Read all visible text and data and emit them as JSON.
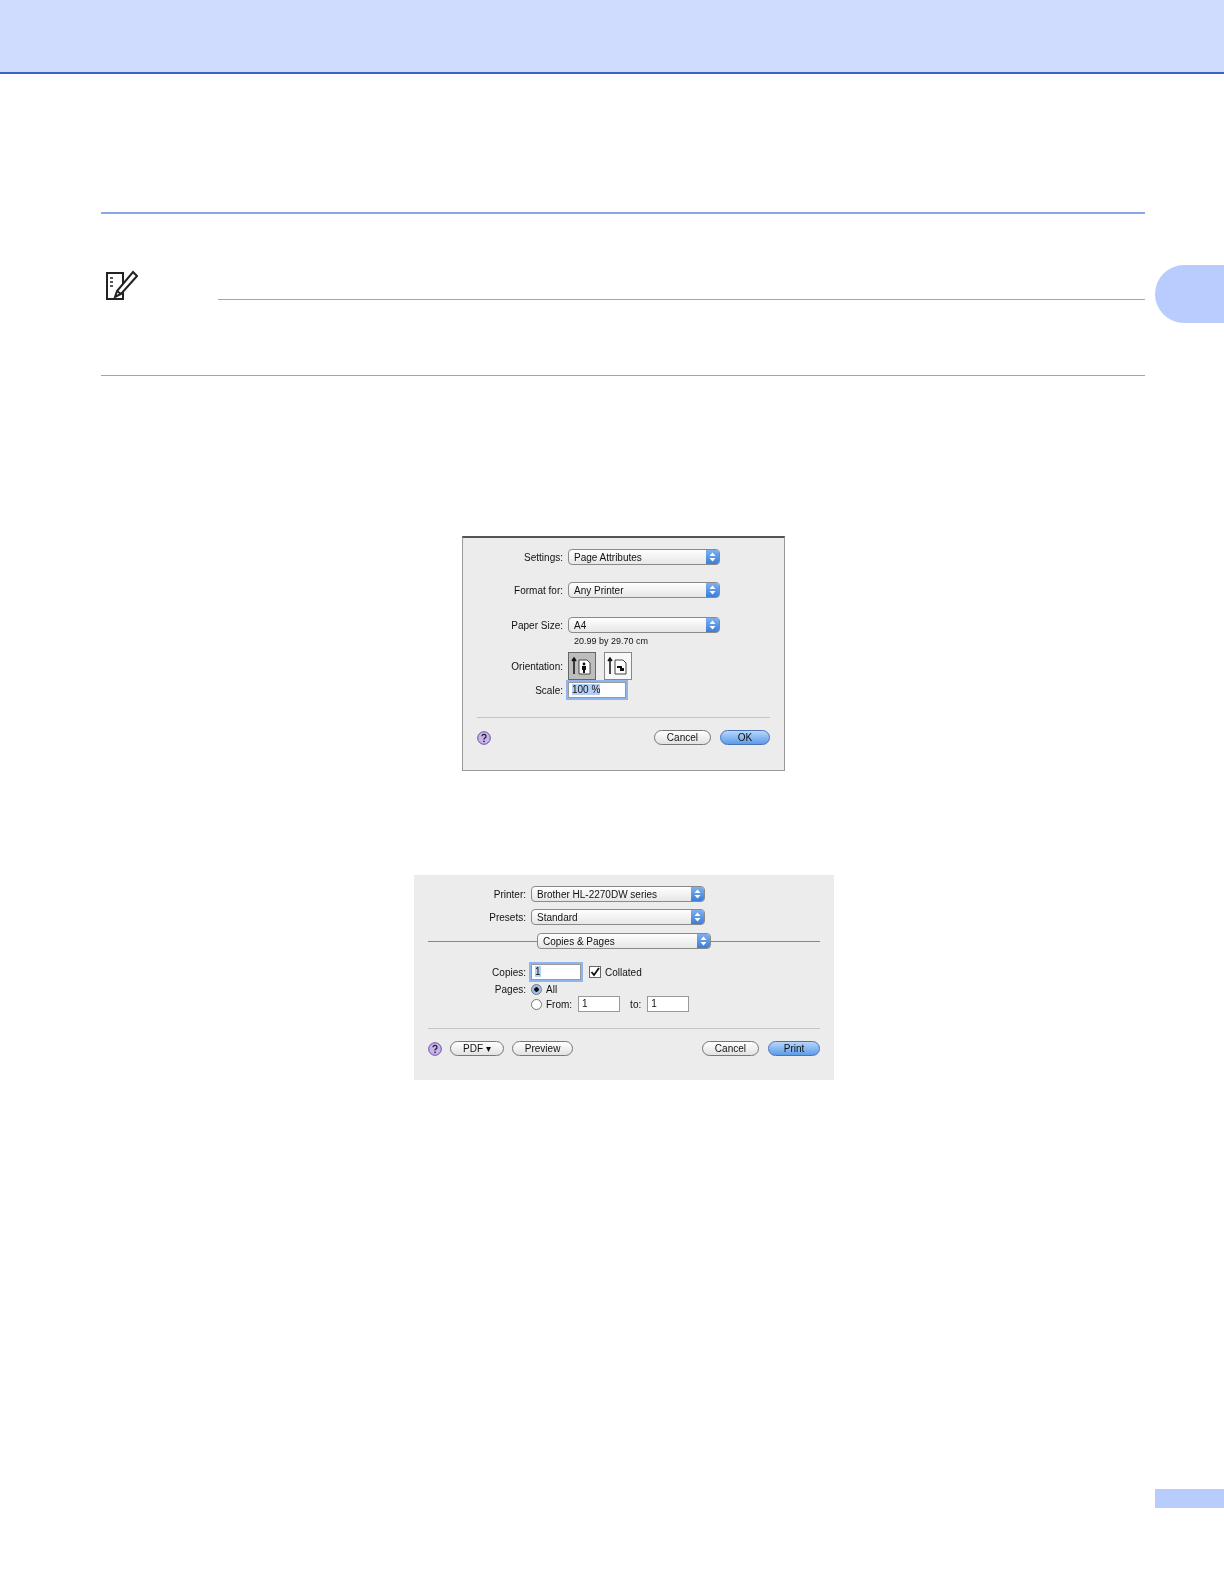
{
  "page_setup_dialog": {
    "rows": [
      {
        "kind": "popup",
        "label": "Settings:",
        "value": "Page Attributes"
      },
      {
        "kind": "popup",
        "label": "Format for:",
        "value": "Any Printer"
      },
      {
        "kind": "popup",
        "label": "Paper Size:",
        "value": "A4",
        "note": "20.99 by 29.70 cm"
      },
      {
        "kind": "orientation",
        "label": "Orientation:",
        "options": [
          {
            "kind": "portrait",
            "selected": true
          },
          {
            "kind": "landscape",
            "selected": false
          }
        ]
      },
      {
        "kind": "text",
        "label": "Scale:",
        "value": "100 %",
        "focused": true
      }
    ],
    "buttons": [
      {
        "label": "Cancel",
        "default": false
      },
      {
        "label": "OK",
        "default": true
      }
    ]
  },
  "print_dialog": {
    "rows": [
      {
        "kind": "popup",
        "label": "Printer:",
        "value": "Brother HL-2270DW series"
      },
      {
        "kind": "popup",
        "label": "Presets:",
        "value": "Standard"
      },
      {
        "kind": "section",
        "value": "Copies & Pages"
      },
      {
        "kind": "copies",
        "label": "Copies:",
        "value": "1",
        "focused": true,
        "checkbox": {
          "label": "Collated",
          "checked": true
        }
      },
      {
        "kind": "radio",
        "label": "Pages:",
        "option": "All",
        "selected": true
      },
      {
        "kind": "range",
        "option": "From:",
        "selected": false,
        "from": "1",
        "to_label": "to:",
        "to": "1"
      }
    ],
    "left_buttons": [
      {
        "label": "PDF ▾"
      },
      {
        "label": "Preview"
      }
    ],
    "buttons": [
      {
        "label": "Cancel",
        "default": false
      },
      {
        "label": "Print",
        "default": true
      }
    ]
  }
}
